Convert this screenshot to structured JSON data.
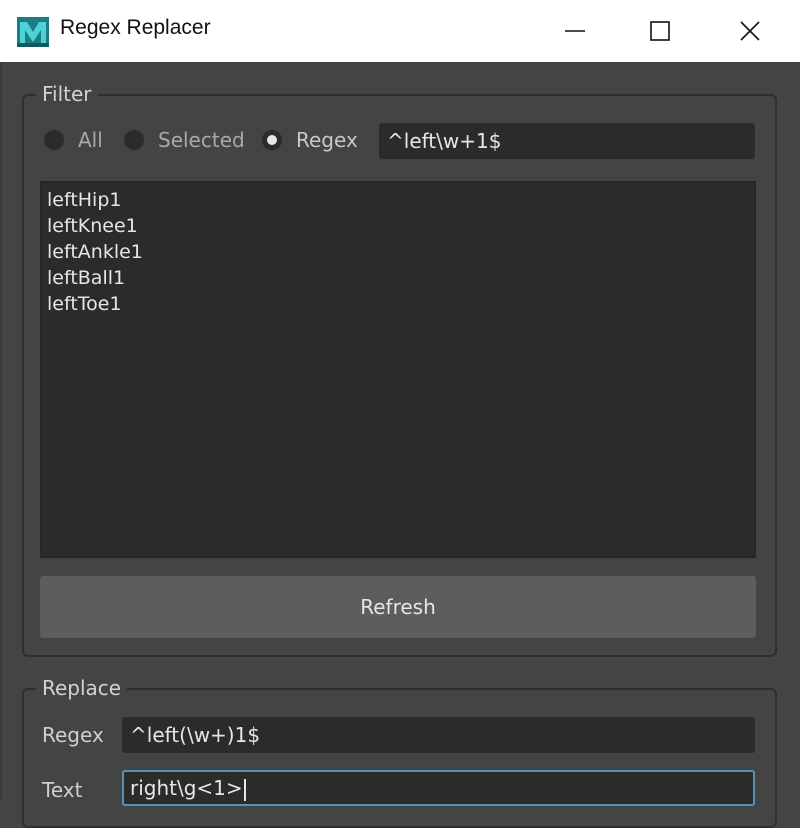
{
  "window": {
    "title": "Regex Replacer"
  },
  "filter": {
    "legend": "Filter",
    "radios": [
      {
        "label": "All",
        "checked": false
      },
      {
        "label": "Selected",
        "checked": false
      },
      {
        "label": "Regex",
        "checked": true
      }
    ],
    "regex_value": "^left\\w+1$",
    "items": [
      "leftHip1",
      "leftKnee1",
      "leftAnkle1",
      "leftBall1",
      "leftToe1"
    ],
    "refresh_label": "Refresh"
  },
  "replace": {
    "legend": "Replace",
    "regex_label": "Regex",
    "regex_value": "^left(\\w+)1$",
    "text_label": "Text",
    "text_value": "right\\g<1>"
  },
  "colors": {
    "background": "#444444",
    "field": "#2b2b2b",
    "focus": "#5a8fb6",
    "accent_icon": "#2fa7b0"
  }
}
